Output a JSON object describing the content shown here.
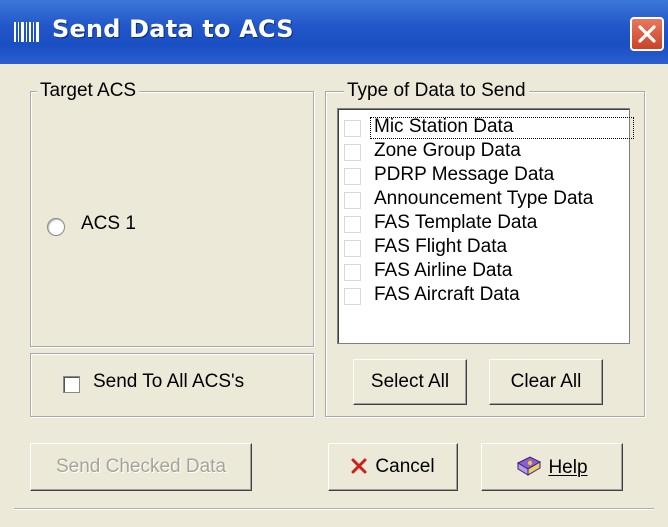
{
  "window": {
    "title": "Send Data to ACS",
    "colors": {
      "titlebar": "#2257c9",
      "close": "#d4502f",
      "face": "#ece9d8"
    }
  },
  "target_group": {
    "legend": "Target ACS",
    "radio_label": "ACS 1",
    "radio_selected": false
  },
  "send_all": {
    "label": "Send To All ACS's",
    "checked": false
  },
  "data_group": {
    "legend": "Type of Data to Send",
    "items": [
      {
        "label": "Mic Station Data",
        "checked": false
      },
      {
        "label": "Zone Group Data",
        "checked": false
      },
      {
        "label": "PDRP Message Data",
        "checked": false
      },
      {
        "label": "Announcement Type Data",
        "checked": false
      },
      {
        "label": "FAS Template Data",
        "checked": false
      },
      {
        "label": "FAS Flight Data",
        "checked": false
      },
      {
        "label": "FAS Airline Data",
        "checked": false
      },
      {
        "label": "FAS Aircraft Data",
        "checked": false
      }
    ]
  },
  "buttons": {
    "select_all": "Select All",
    "clear_all": "Clear All",
    "send_checked": "Send Checked Data",
    "cancel": "Cancel",
    "help": "Help"
  },
  "icons": {
    "app": "barcode-icon",
    "close": "close-icon",
    "cancel": "red-x-icon",
    "help": "help-book-icon"
  }
}
